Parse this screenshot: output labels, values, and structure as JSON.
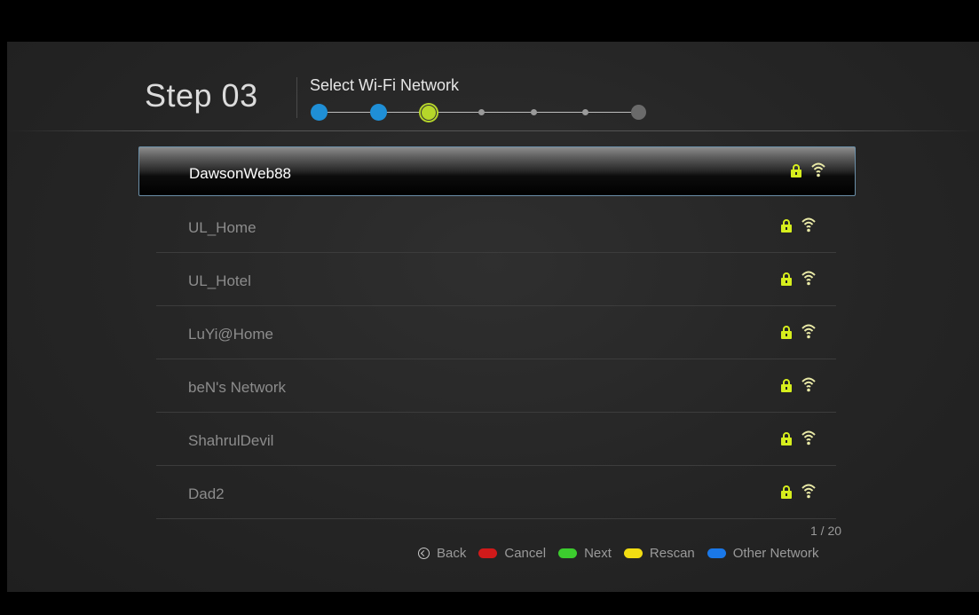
{
  "header": {
    "step_label": "Step 03",
    "step_name": "Select Wi-Fi Network"
  },
  "progress": {
    "total_steps": 7,
    "current_step": 3
  },
  "networks": [
    {
      "name": "DawsonWeb88",
      "secured": true,
      "selected": true
    },
    {
      "name": "UL_Home",
      "secured": true,
      "selected": false
    },
    {
      "name": "UL_Hotel",
      "secured": true,
      "selected": false
    },
    {
      "name": "LuYi@Home",
      "secured": true,
      "selected": false
    },
    {
      "name": "beN's Network",
      "secured": true,
      "selected": false
    },
    {
      "name": "ShahrulDevil",
      "secured": true,
      "selected": false
    },
    {
      "name": "Dad2",
      "secured": true,
      "selected": false
    }
  ],
  "pagination": "1 / 20",
  "footer": {
    "back_label": "Back",
    "cancel_label": "Cancel",
    "next_label": "Next",
    "rescan_label": "Rescan",
    "other_network_label": "Other Network"
  },
  "icons": {
    "lock": "lock-icon",
    "wifi": "wifi-signal-icon",
    "back": "back-button-icon"
  },
  "colors": {
    "completed_step": "#1f8fd6",
    "current_step": "#b6d62a",
    "lock": "#d6ee1d",
    "wifi": "#e9e9a6",
    "cancel": "#d01a1a",
    "next": "#3ccc2e",
    "rescan": "#f2dd12",
    "other_network": "#1a78e8"
  }
}
